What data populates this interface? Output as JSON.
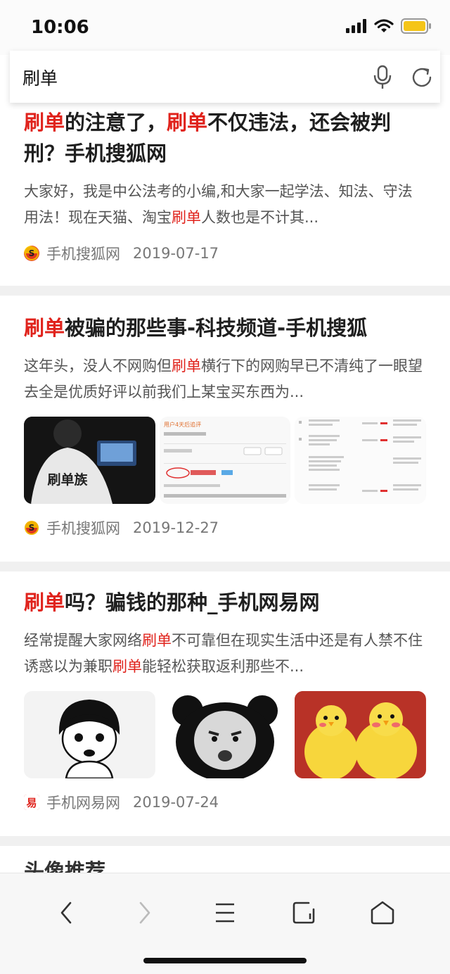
{
  "status_bar": {
    "time": "10:06",
    "icons": [
      "signal-icon",
      "wifi-icon",
      "battery-icon"
    ],
    "battery_color": "#f5c518"
  },
  "search": {
    "query": "刷单",
    "icons": [
      "microphone-icon",
      "refresh-icon"
    ]
  },
  "colors": {
    "highlight": "#e0231c",
    "text": "#1f1f1f",
    "snippet": "#555555",
    "meta": "#777777"
  },
  "results": [
    {
      "title_parts": [
        {
          "text": "刷单",
          "highlight": true
        },
        {
          "text": "的注意了，",
          "highlight": false
        },
        {
          "text": "刷单",
          "highlight": true
        },
        {
          "text": "不仅违法，还会被判刑？手机搜狐网",
          "highlight": false
        }
      ],
      "snippet_parts": [
        {
          "text": "大家好，我是中公法考的小编,和大家一起学法、知法、守法用法！现在天猫、淘宝",
          "highlight": false
        },
        {
          "text": "刷单",
          "highlight": true
        },
        {
          "text": "人数也是不计其...",
          "highlight": false
        }
      ],
      "source": "手机搜狐网",
      "source_icon": "sohu-logo-icon",
      "date": "2019-07-17"
    },
    {
      "title_parts": [
        {
          "text": "刷单",
          "highlight": true
        },
        {
          "text": "被骗的那些事-科技频道-手机搜狐",
          "highlight": false
        }
      ],
      "snippet_parts": [
        {
          "text": "这年头，没人不网购但",
          "highlight": false
        },
        {
          "text": "刷单",
          "highlight": true
        },
        {
          "text": "横行下的网购早已不清纯了一眼望去全是优质好评以前我们上某宝买东西为...",
          "highlight": false
        }
      ],
      "images": [
        {
          "name": "person-shirt-image",
          "text": "刷单族"
        },
        {
          "name": "review-screenshot-image",
          "text": "用户4天后追评"
        },
        {
          "name": "chat-screenshot-image",
          "text": ""
        }
      ],
      "source": "手机搜狐网",
      "source_icon": "sohu-logo-icon",
      "date": "2019-12-27"
    },
    {
      "title_parts": [
        {
          "text": "刷单",
          "highlight": true
        },
        {
          "text": "吗？骗钱的那种_手机网易网",
          "highlight": false
        }
      ],
      "snippet_parts": [
        {
          "text": "经常提醒大家网络",
          "highlight": false
        },
        {
          "text": "刷单",
          "highlight": true
        },
        {
          "text": "不可靠但在现实生活中还是有人禁不住诱惑以为兼职",
          "highlight": false
        },
        {
          "text": "刷单",
          "highlight": true
        },
        {
          "text": "能轻松获取返利那些不...",
          "highlight": false
        }
      ],
      "images": [
        {
          "name": "cartoon-girl-meme-image",
          "text": ""
        },
        {
          "name": "panda-meme-image",
          "text": ""
        },
        {
          "name": "yellow-chicks-image",
          "text": ""
        }
      ],
      "source": "手机网易网",
      "source_icon": "netease-logo-icon",
      "date": "2019-07-24"
    }
  ],
  "partial_section_title": "头像推荐",
  "bottom_nav": {
    "items": [
      "back-icon",
      "forward-icon",
      "menu-icon",
      "tabs-icon",
      "home-icon"
    ]
  }
}
